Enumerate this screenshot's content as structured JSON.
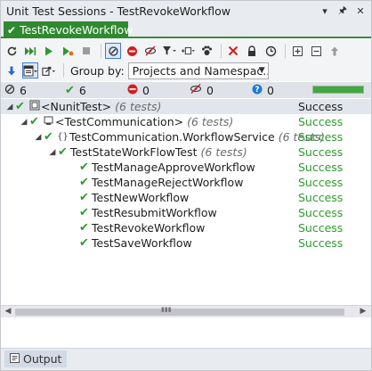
{
  "window": {
    "title": "Unit Test Sessions - TestRevokeWorkflow",
    "buttons": {
      "menu": "▾",
      "pin": "🖈",
      "close": "✕"
    }
  },
  "doc_tab": {
    "label": "TestRevokeWorkflow",
    "icon": "✔"
  },
  "toolbar1": {
    "icons": [
      "refresh-icon",
      "run-all-icon",
      "run-icon",
      "debug-icon",
      "stop-icon",
      "track-running-icon",
      "stop-all-icon",
      "hide-icon",
      "filter-icon",
      "run-options-icon",
      "profile-icon",
      "remove-icon",
      "lock-icon",
      "timer-icon",
      "expand-all-icon",
      "collapse-all-icon",
      "move-up-icon"
    ]
  },
  "toolbar2": {
    "group_by_label": "Group by:",
    "group_by_value": "Projects and Namespac..."
  },
  "status": {
    "total": "6",
    "passed": "0",
    "failed_count": "6",
    "failed": "0",
    "ignored": "0",
    "unknown": "0",
    "progress_fraction": 1.0,
    "accent": "#42a642"
  },
  "tree": {
    "rows": [
      {
        "name": "<NunitTest>",
        "meta": "(6 tests)",
        "result": "Success"
      },
      {
        "name": "<TestCommunication>",
        "meta": "(6 tests)",
        "result": "Success"
      },
      {
        "name": "TestCommunication.WorkflowService",
        "meta": "(6 tests)",
        "result": "Success"
      },
      {
        "name": "TestStateWorkFlowTest",
        "meta": "(6 tests)",
        "result": "Success"
      },
      {
        "name": "TestManageApproveWorkflow",
        "meta": "",
        "result": "Success"
      },
      {
        "name": "TestManageRejectWorkflow",
        "meta": "",
        "result": "Success"
      },
      {
        "name": "TestNewWorkflow",
        "meta": "",
        "result": "Success"
      },
      {
        "name": "TestResubmitWorkflow",
        "meta": "",
        "result": "Success"
      },
      {
        "name": "TestRevokeWorkflow",
        "meta": "",
        "result": "Success"
      },
      {
        "name": "TestSaveWorkflow",
        "meta": "",
        "result": "Success"
      }
    ]
  },
  "bottom_tab": {
    "label": "Output"
  }
}
